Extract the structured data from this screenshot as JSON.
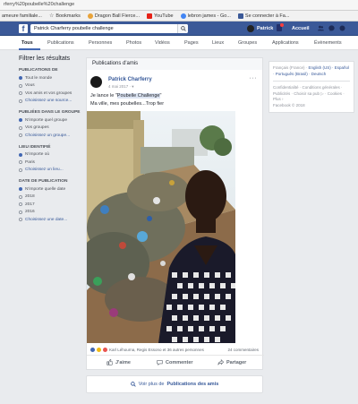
{
  "browser": {
    "url": "rferry%20poubelle%20challenge",
    "bookmarks": [
      {
        "label": "ameure familiale...",
        "icon": "page-icon"
      },
      {
        "label": "Bookmarks",
        "icon": "star-icon"
      },
      {
        "label": "Dragon Ball Fierce...",
        "icon": "dragon-icon"
      },
      {
        "label": "YouTube",
        "icon": "youtube-icon"
      },
      {
        "label": "lebron james - Go...",
        "icon": "google-icon"
      },
      {
        "label": "Se connecter à Fa...",
        "icon": "facebook-icon"
      }
    ]
  },
  "header": {
    "logo": "f",
    "search_value": "Patrick Charferry poubelle challenge",
    "user_name": "Patrick",
    "home_label": "Accueil"
  },
  "tabs": [
    "Tous",
    "Publications",
    "Personnes",
    "Photos",
    "Vidéos",
    "Pages",
    "Lieux",
    "Groupes",
    "Applications",
    "Évènements"
  ],
  "filters": {
    "heading": "Filtrer les résultats",
    "sections": [
      {
        "title": "PUBLICATIONS DE",
        "options": [
          "Tout le monde",
          "Vous",
          "Vos amis et vos groupes"
        ],
        "link": "Choisissez une source..."
      },
      {
        "title": "PUBLIÉES DANS LE GROUPE",
        "options": [
          "N'importe quel groupe",
          "Vos groupes"
        ],
        "link": "Choisissez un groupe..."
      },
      {
        "title": "LIEU IDENTIFIÉ",
        "options": [
          "N'importe où",
          "Paris"
        ],
        "link": "Choisissez un lieu..."
      },
      {
        "title": "DATE DE PUBLICATION",
        "options": [
          "N'importe quelle date",
          "2018",
          "2017",
          "2016"
        ],
        "link": "Choisissez une date..."
      }
    ]
  },
  "feed": {
    "section_title": "Publications d'amis",
    "post": {
      "author": "Patrick Charferry",
      "date": "4 mai 2017 · ",
      "text_before": "Je lance le \"",
      "text_highlight": "Poubelle Challenge",
      "text_after": "\"",
      "text_line2": "Ma ville, mes poubelles...Trop fier",
      "reactions_text": "Karl Léhourna, Regis Essono et 36 autres personnes",
      "comments_count": "24 commentaires",
      "like_label": "J'aime",
      "comment_label": "Commenter",
      "share_label": "Partager"
    },
    "see_more_prefix": "Voir plus de ",
    "see_more_bold": "Publications des amis"
  },
  "rightcol": {
    "lang_current": "Français (France) · ",
    "lang_links": "English (US) · Español · Português (Brasil) · Deutsch",
    "footer_links": "Confidentialité · Conditions générales · Publicités · Choisir sa pub ▷ · Cookies · Plus ›",
    "copyright": "Facebook © 2018"
  },
  "colors": {
    "fb_blue": "#3b5998",
    "link": "#365899",
    "background": "#e9ebee"
  }
}
